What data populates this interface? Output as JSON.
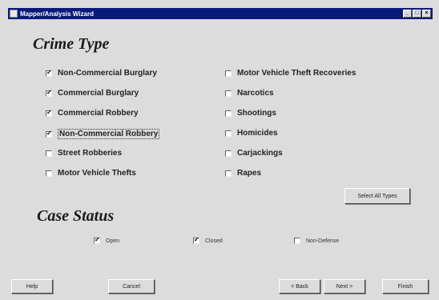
{
  "window": {
    "title": "Mapper/Analysis Wizard"
  },
  "crime_type": {
    "heading": "Crime Type",
    "left": [
      {
        "label": "Non-Commercial Burglary",
        "checked": true
      },
      {
        "label": "Commercial Burglary",
        "checked": true
      },
      {
        "label": "Commercial Robbery",
        "checked": true
      },
      {
        "label": "Non-Commercial Robbery",
        "checked": true
      },
      {
        "label": "Street Robberies",
        "checked": false
      },
      {
        "label": "Motor Vehicle Thefts",
        "checked": false
      }
    ],
    "right": [
      {
        "label": "Motor Vehicle Theft Recoveries",
        "checked": false
      },
      {
        "label": "Narcotics",
        "checked": false
      },
      {
        "label": "Shootings",
        "checked": false
      },
      {
        "label": "Homicides",
        "checked": false
      },
      {
        "label": "Carjackings",
        "checked": false
      },
      {
        "label": "Rapes",
        "checked": false
      }
    ],
    "select_all_label": "Select All Types"
  },
  "case_status": {
    "heading": "Case Status",
    "open": {
      "label": "Open",
      "checked": true
    },
    "closed": {
      "label": "Closed",
      "checked": true
    },
    "non_defense": {
      "label": "Non-Defense",
      "checked": false
    }
  },
  "footer": {
    "help": "Help",
    "cancel": "Cancel",
    "back": "< Back",
    "next": "Next >",
    "finish": "Finish"
  },
  "check_mark": "✓"
}
